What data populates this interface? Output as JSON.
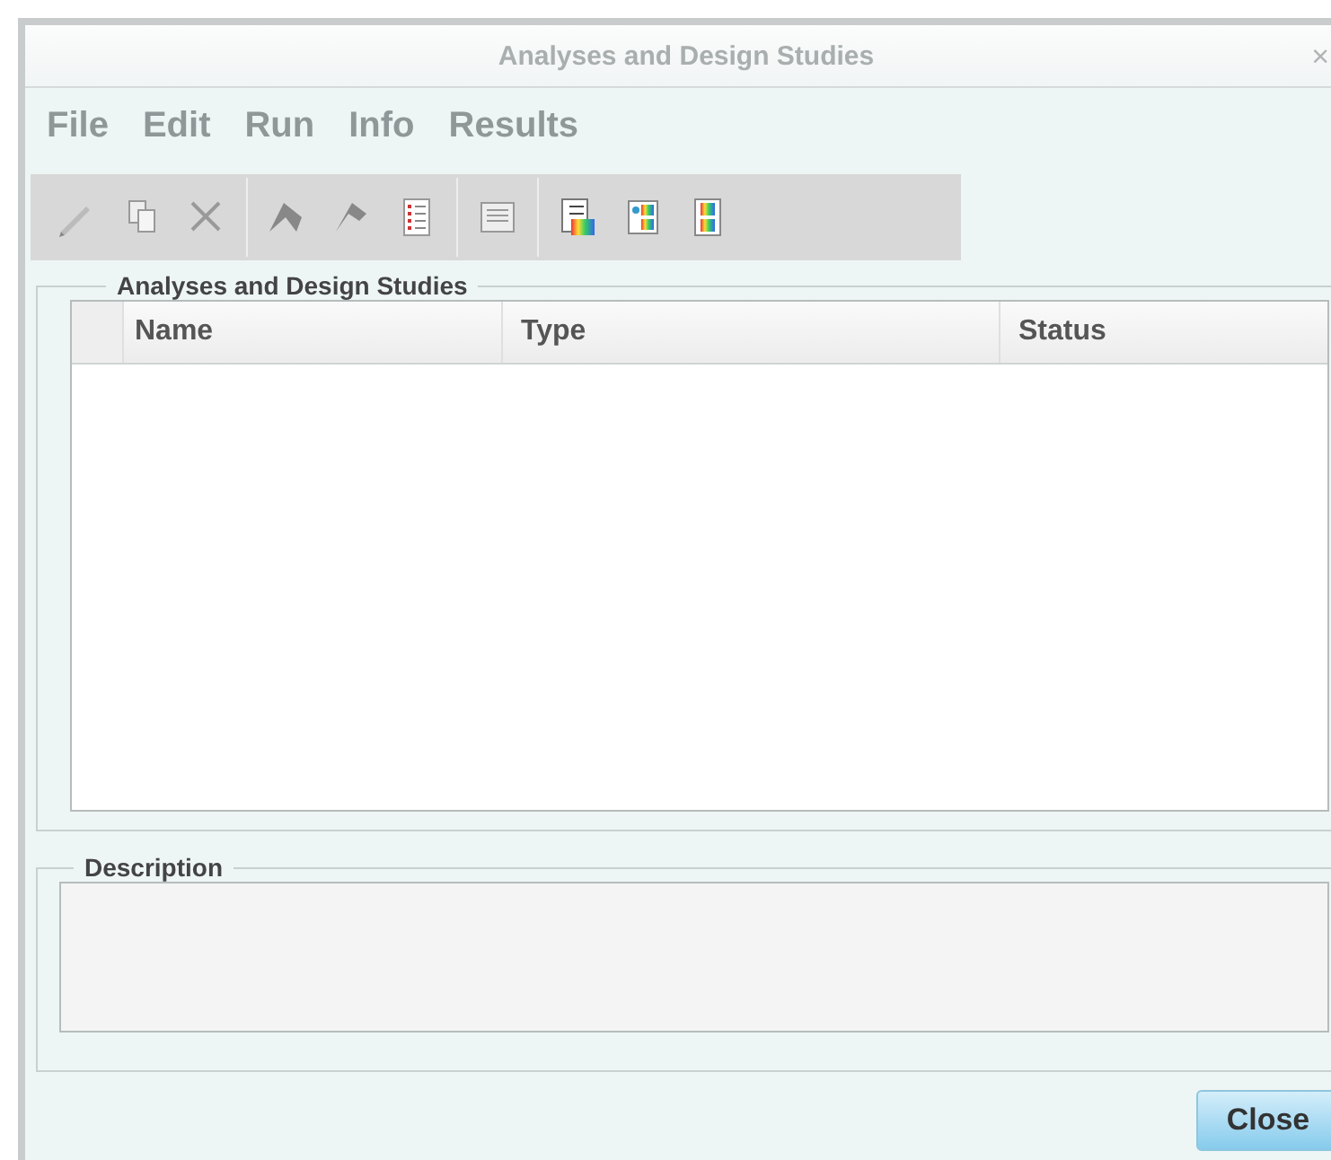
{
  "window": {
    "title": "Analyses and Design Studies",
    "close": "×"
  },
  "menu": [
    {
      "label": "File",
      "disabled": true
    },
    {
      "label": "Edit",
      "disabled": true
    },
    {
      "label": "Run",
      "disabled": true
    },
    {
      "label": "Info",
      "disabled": true
    },
    {
      "label": "Results",
      "disabled": true
    }
  ],
  "studies": {
    "title": "Analyses and Design Studies",
    "columns": [
      "Name",
      "Type",
      "Status"
    ]
  },
  "description": {
    "title": "Description"
  },
  "buttons": [
    "Close"
  ]
}
